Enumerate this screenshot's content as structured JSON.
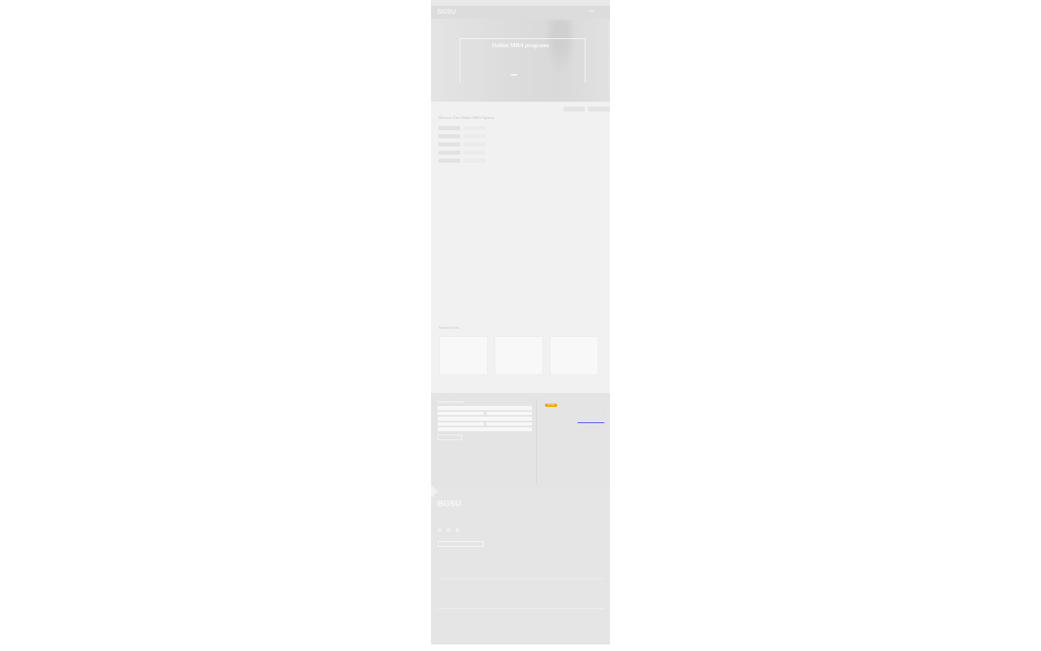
{
  "utility": {
    "links": [
      "",
      "",
      ""
    ]
  },
  "header": {
    "logo": "BGSU",
    "nav": [
      "",
      "",
      ""
    ],
    "apply": ""
  },
  "hero": {
    "title": "Online MBA programs",
    "text": "",
    "primary_button": "",
    "secondary_button": "",
    "credit": ""
  },
  "subbar": {
    "breadcrumb": "",
    "contact": "",
    "button_1": "",
    "button_2": ""
  },
  "main": {
    "heading": "Discover Our Online MBA Options",
    "intro": "",
    "options": [
      {
        "title": "",
        "details": "",
        "primary": "",
        "secondary": ""
      },
      {
        "title": "",
        "details": "",
        "primary": "",
        "secondary": ""
      },
      {
        "title": "",
        "details": "",
        "primary": "",
        "secondary": ""
      },
      {
        "title": "",
        "details": "",
        "primary": "",
        "secondary": ""
      },
      {
        "title": "",
        "details": "",
        "primary": "",
        "secondary": ""
      }
    ],
    "note": "",
    "subheading": "",
    "paragraphs": [
      "",
      "",
      "",
      ""
    ]
  },
  "related": {
    "heading": "Related Articles",
    "cards": [
      {
        "category": "",
        "title": "",
        "summary": "",
        "more": ""
      },
      {
        "category": "",
        "title": "",
        "summary": "",
        "more": ""
      },
      {
        "category": "",
        "title": "",
        "summary": "",
        "more": ""
      }
    ],
    "controls": "‹ ›"
  },
  "request": {
    "heading": "Request Information",
    "subtext": "",
    "fields": [
      "",
      "",
      "",
      "",
      "",
      "",
      ""
    ],
    "submit": "",
    "legal": ""
  },
  "chat": {
    "heading": "",
    "chat_button": "Chat Now",
    "call": "",
    "call_number": "",
    "email": "",
    "caret": "›"
  },
  "footer": {
    "logo": "BGSU",
    "address": "",
    "button": "",
    "accessibility": "",
    "legal_1": "",
    "legal_2": "",
    "legal_3": ""
  }
}
